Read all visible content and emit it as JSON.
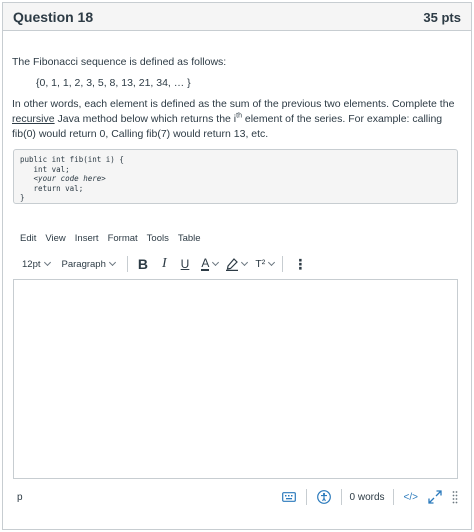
{
  "question": {
    "title": "Question 18",
    "points": "35 pts",
    "intro": "The Fibonacci sequence is defined as follows:",
    "sequence": "{0, 1, 1, 2, 3, 5, 8, 13, 21, 34, … }",
    "para_a": "In other words, each element is defined as the sum of the previous two elements. Complete the ",
    "para_link": "recursive",
    "para_b": " Java method below which returns the i",
    "para_sup": "th",
    "para_c": " element of the series. For example: calling fib(0) would return 0, Calling fib(7) would return 13, etc."
  },
  "code": {
    "line1": "public int fib(int i) {",
    "line2": "   int val;",
    "line3": "   <your code here>",
    "line4": "   return val;",
    "line5": "}"
  },
  "editor": {
    "menu": [
      "Edit",
      "View",
      "Insert",
      "Format",
      "Tools",
      "Table"
    ],
    "font_size": "12pt",
    "block_format": "Paragraph",
    "bold": "B",
    "italic": "I",
    "underline": "U",
    "text_color": "A",
    "superscript": "T²",
    "more": "⋮",
    "status_path": "p",
    "word_count": "0 words",
    "html_toggle": "</>"
  },
  "colors": {
    "accent": "#2b7abc",
    "border": "#c7cdd1",
    "text": "#2d3b45",
    "header_bg": "#f5f5f5"
  }
}
